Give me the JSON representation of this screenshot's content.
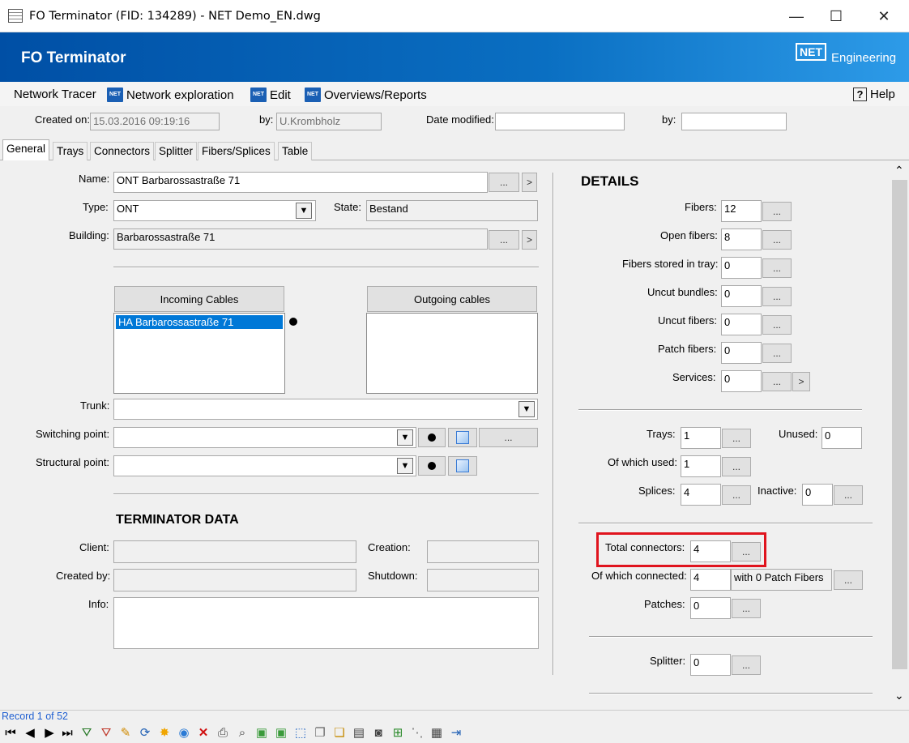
{
  "window": {
    "title": "FO Terminator (FID: 134289) - NET Demo_EN.dwg",
    "min": "—",
    "max": "☐",
    "close": "✕"
  },
  "banner": {
    "app_title": "FO Terminator",
    "logo_text": "NET",
    "logo_label": "Engineering"
  },
  "menu": {
    "items": [
      "Network Tracer",
      "Network exploration",
      "Edit",
      "Overviews/Reports"
    ],
    "help": "Help",
    "help_glyph": "?",
    "icon_text": "NET"
  },
  "header": {
    "created_on_label": "Created on:",
    "created_on": "15.03.2016 09:19:16",
    "by_label": "by:",
    "by": "U.Krombholz",
    "modified_label": "Date modified:",
    "modified": "",
    "by2_label": "by:",
    "by2": ""
  },
  "tabs": [
    "General",
    "Trays",
    "Connectors",
    "Splitter",
    "Fibers/Splices",
    "Table"
  ],
  "general": {
    "name_label": "Name:",
    "name": "ONT Barbarossastraße 71",
    "type_label": "Type:",
    "type": "ONT",
    "state_label": "State:",
    "state": "Bestand",
    "building_label": "Building:",
    "building": "Barbarossastraße 71",
    "incoming_label": "Incoming Cables",
    "outgoing_label": "Outgoing cables",
    "incoming_items": [
      "HA Barbarossastraße 71"
    ],
    "trunk_label": "Trunk:",
    "switching_label": "Switching point:",
    "structural_label": "Structural point:",
    "terminator_title": "TERMINATOR DATA",
    "client_label": "Client:",
    "creation_label": "Creation:",
    "created_by_label": "Created by:",
    "shutdown_label": "Shutdown:",
    "info_label": "Info:"
  },
  "details": {
    "title": "DETAILS",
    "fibers_label": "Fibers:",
    "fibers": "12",
    "open_fibers_label": "Open fibers:",
    "open_fibers": "8",
    "stored_label": "Fibers stored in tray:",
    "stored": "0",
    "uncut_bundles_label": "Uncut bundles:",
    "uncut_bundles": "0",
    "uncut_fibers_label": "Uncut fibers:",
    "uncut_fibers": "0",
    "patch_fibers_label": "Patch fibers:",
    "patch_fibers": "0",
    "services_label": "Services:",
    "services": "0",
    "trays_label": "Trays:",
    "trays": "1",
    "unused_label": "Unused:",
    "unused": "0",
    "of_which_used_label": "Of which used:",
    "of_which_used": "1",
    "splices_label": "Splices:",
    "splices": "4",
    "inactive_label": "Inactive:",
    "inactive": "0",
    "total_connectors_label": "Total connectors:",
    "total_connectors": "4",
    "of_which_connected_label": "Of which connected:",
    "of_which_connected": "4",
    "patch_note": "with 0 Patch Fibers",
    "patches_label": "Patches:",
    "patches": "0",
    "splitter_label": "Splitter:",
    "splitter": "0"
  },
  "ellipsis": "...",
  "arrow_right": ">",
  "arrow_down": "▼",
  "scroll": {
    "up": "⌃",
    "down": "⌄"
  },
  "status": {
    "record": "Record 1 of 52"
  }
}
